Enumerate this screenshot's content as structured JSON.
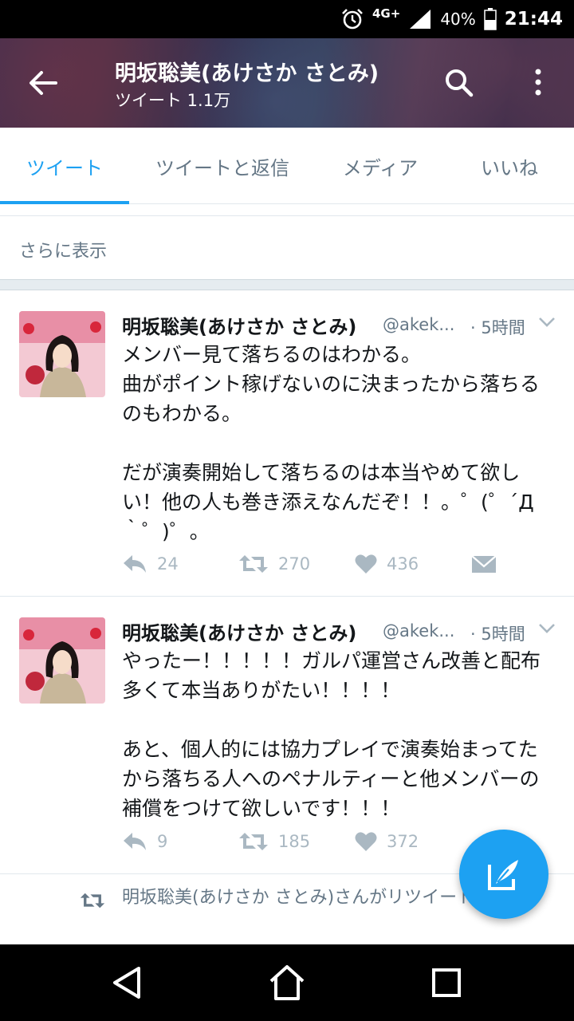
{
  "status_bar": {
    "network": "4G+",
    "battery": "40%",
    "time": "21:44"
  },
  "header": {
    "title": "明坂聡美(あけさか さとみ)",
    "subtitle": "ツイート 1.1万"
  },
  "tabs": [
    {
      "label": "ツイート",
      "active": true
    },
    {
      "label": "ツイートと返信",
      "active": false
    },
    {
      "label": "メディア",
      "active": false
    },
    {
      "label": "いいね",
      "active": false
    }
  ],
  "show_more": "さらに表示",
  "tweets": [
    {
      "name": "明坂聡美(あけさか さとみ)",
      "handle": "@akek...",
      "time": "· 5時間",
      "text": "メンバー見て落ちるのはわかる。\n曲がポイント稼げないのに決まったから落ちるのもわかる。\n\nだが演奏開始して落ちるのは本当やめて欲しい！他の人も巻き添えなんだぞ！！。゜(゜´Д\n｀゜)゜。",
      "replies": "24",
      "retweets": "270",
      "likes": "436"
    },
    {
      "name": "明坂聡美(あけさか さとみ)",
      "handle": "@akek...",
      "time": "· 5時間",
      "text": "やったー！！！！！ガルパ運営さん改善と配布多くて本当ありがたい！！！！\n\nあと、個人的には協力プレイで演奏始まってたから落ちる人へのペナルティーと他メンバーの補償をつけて欲しいです！！！",
      "replies": "9",
      "retweets": "185",
      "likes": "372"
    }
  ],
  "retweet_notice": "明坂聡美(あけさか さとみ)さんがリツイートした",
  "colors": {
    "accent": "#1da1f2",
    "secondary_text": "#657786",
    "action_icon": "#aab8c2"
  }
}
